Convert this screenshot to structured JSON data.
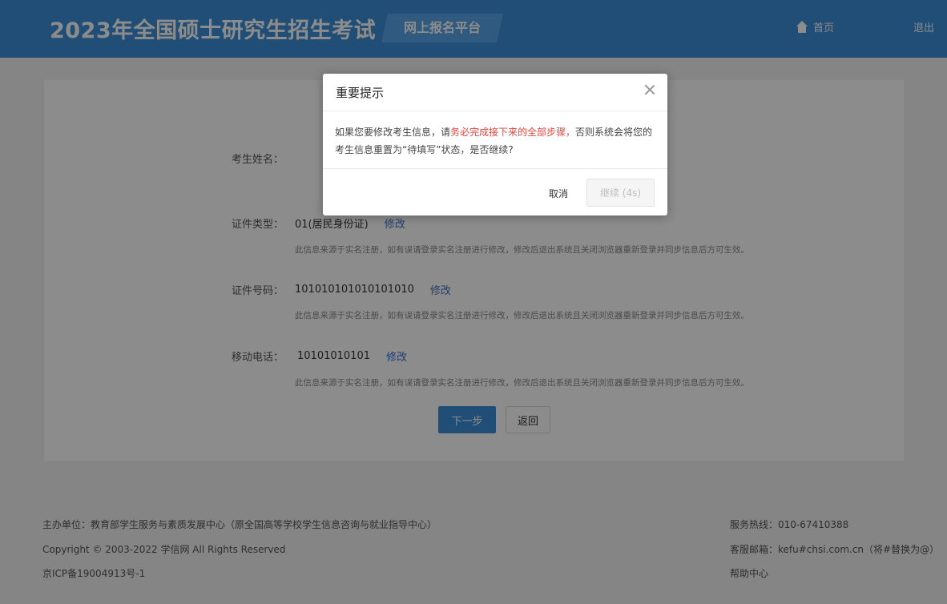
{
  "header": {
    "title": "2023年全国硕士研究生招生考试",
    "platform": "网上报名平台",
    "home_label": "首页",
    "logout_label": "退出"
  },
  "form": {
    "rows": [
      {
        "label": "考生姓名：",
        "value": "",
        "edit_label": "",
        "note": ""
      },
      {
        "label": "证件类型：",
        "value": "01(居民身份证)",
        "edit_label": "修改",
        "note": "此信息来源于实名注册，如有误请登录实名注册进行修改，修改后退出系统且关闭浏览器重新登录并同步信息后方可生效。"
      },
      {
        "label": "证件号码：",
        "value": "101010101010101010",
        "edit_label": "修改",
        "note": "此信息来源于实名注册，如有误请登录实名注册进行修改，修改后退出系统且关闭浏览器重新登录并同步信息后方可生效。"
      },
      {
        "label": "移动电话：",
        "value": "10101010101",
        "edit_label": "修改",
        "note": "此信息来源于实名注册，如有误请登录实名注册进行修改，修改后退出系统且关闭浏览器重新登录并同步信息后方可生效。"
      }
    ],
    "next_label": "下一步",
    "back_label": "返回"
  },
  "footer": {
    "host": "主办单位：教育部学生服务与素质发展中心（原全国高等学校学生信息咨询与就业指导中心）",
    "copyright": "Copyright © 2003-2022 学信网 All Rights Reserved",
    "icp": "京ICP备19004913号-1",
    "hotline": "服务热线：010-67410388",
    "email": "客服邮箱：kefu#chsi.com.cn（将#替换为@）",
    "help": "帮助中心"
  },
  "modal": {
    "title": "重要提示",
    "message_part1": "如果您要修改考生信息，请",
    "message_warning": "务必完成接下来的全部步骤，",
    "message_part2": "否则系统会将您的考生信息重置为“待填写”状态，是否继续?",
    "cancel_label": "取消",
    "confirm_label": "继续 (4s)"
  },
  "colors": {
    "header_bg": "#3b8ed8",
    "warning_text": "#e0463c",
    "link": "#3b6fc4"
  }
}
